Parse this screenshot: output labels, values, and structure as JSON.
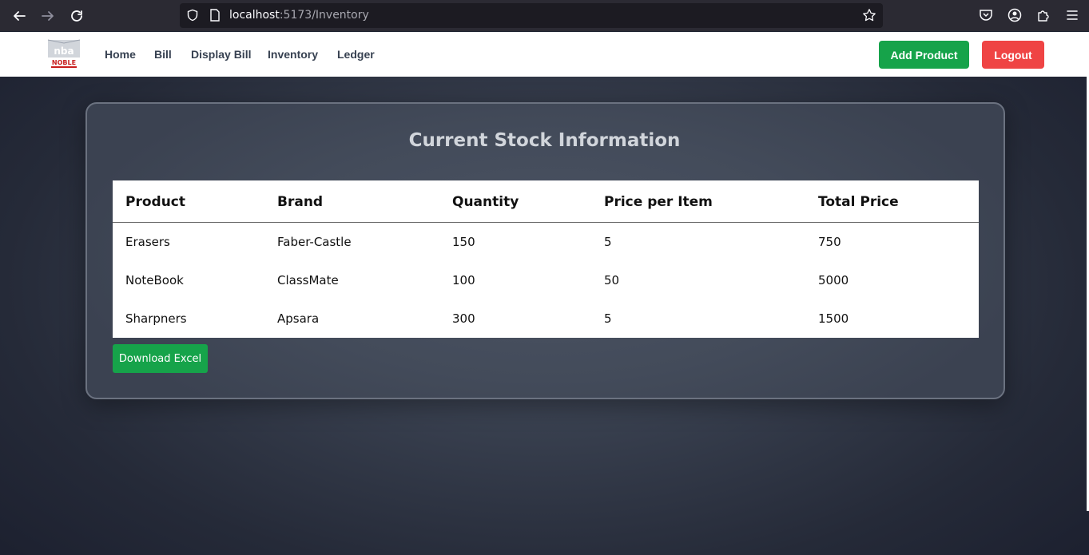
{
  "browser": {
    "url_host": "localhost",
    "url_rest": ":5173/Inventory"
  },
  "nav": {
    "logo_text": "NOBLE",
    "links": [
      "Home",
      "Bill",
      "Display Bill",
      "Inventory",
      "Ledger"
    ],
    "add_product_label": "Add Product",
    "logout_label": "Logout"
  },
  "main": {
    "title": "Current Stock Information",
    "table": {
      "headers": [
        "Product",
        "Brand",
        "Quantity",
        "Price per Item",
        "Total Price"
      ],
      "rows": [
        [
          "Erasers",
          "Faber-Castle",
          "150",
          "5",
          "750"
        ],
        [
          "NoteBook",
          "ClassMate",
          "100",
          "50",
          "5000"
        ],
        [
          "Sharpners",
          "Apsara",
          "300",
          "5",
          "1500"
        ]
      ]
    },
    "download_label": "Download Excel"
  },
  "colors": {
    "green": "#16a34a",
    "red": "#ef4444",
    "chrome": "#2b2a33"
  }
}
